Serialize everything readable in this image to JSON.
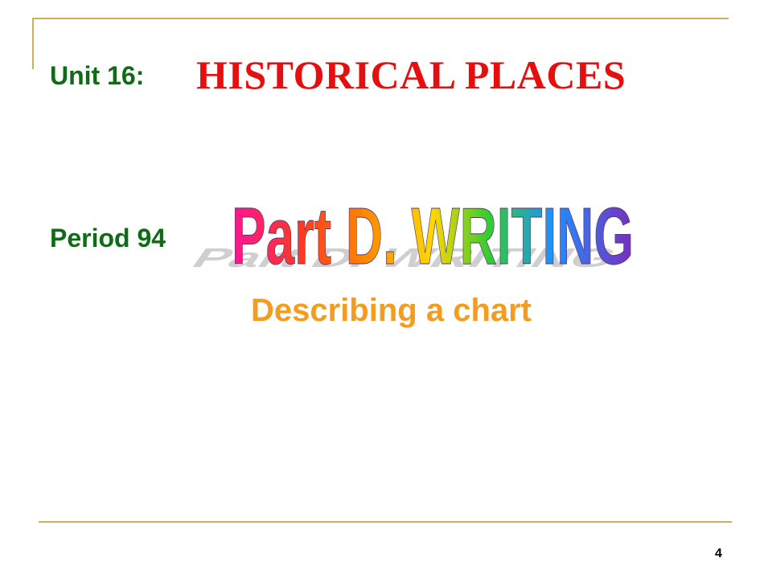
{
  "slide": {
    "unit_label": "Unit 16:",
    "unit_title": "HISTORICAL PLACES",
    "period_label": "Period 94",
    "part_title": "Part D. WRITING",
    "subtitle": "Describing a chart",
    "page_number": "4"
  },
  "colors": {
    "frame_line": "#c8b35a",
    "unit_label": "#0f6b15",
    "unit_title": "#e60f0f",
    "subtitle": "#f39c1f",
    "wordart_shadow": "#a9a9a9",
    "wordart_gradient": [
      "#ff1493",
      "#ff3b1f",
      "#ff8c00",
      "#ffd700",
      "#32cd32",
      "#1e90ff",
      "#7b2cbf"
    ]
  }
}
